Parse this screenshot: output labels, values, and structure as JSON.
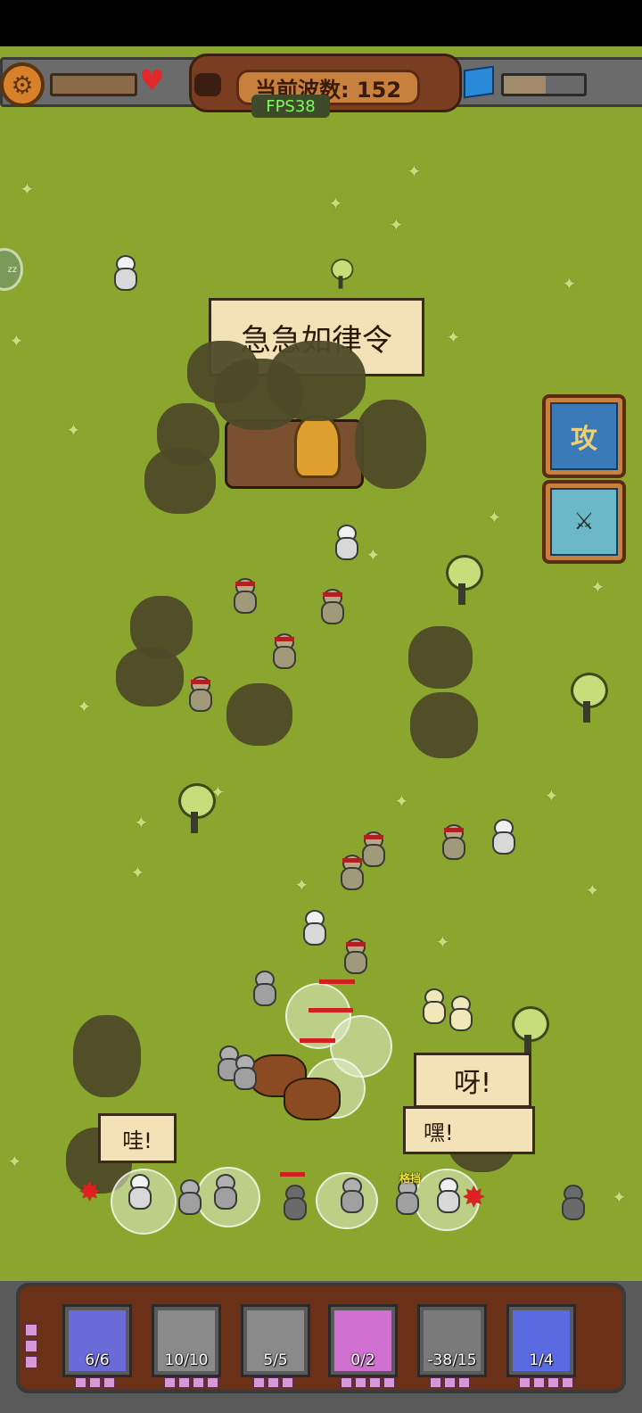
{
  "hud": {
    "settings_icon": "gear-icon",
    "health_icon": "heart-icon",
    "resource_icon": "cube-icon",
    "wave_label": "当前波数: 152",
    "fps": "FPS38",
    "left_tab_label": "zz"
  },
  "side_buttons": {
    "attack_label": "攻",
    "shop_label": "⚔"
  },
  "speech": {
    "main": "急急如律令",
    "right_top": "呀!",
    "right_bottom": "嘿!",
    "left_bottom": "哇!",
    "small_label": "格挡"
  },
  "units": [
    {
      "count": "6/6",
      "bg": "#6a6ad8",
      "pips": 3
    },
    {
      "count": "10/10",
      "bg": "#8a8a8a",
      "pips": 4
    },
    {
      "count": "5/5",
      "bg": "#8a8a8a",
      "pips": 3
    },
    {
      "count": "0/2",
      "bg": "#d070d0",
      "pips": 4
    },
    {
      "count": "-38/15",
      "bg": "#7a7a7a",
      "pips": 3
    },
    {
      "count": "1/4",
      "bg": "#5a6ae0",
      "pips": 4
    }
  ],
  "colors": {
    "grass": "#8aa62e",
    "panel": "#6a3018",
    "accent": "#c7803e"
  }
}
